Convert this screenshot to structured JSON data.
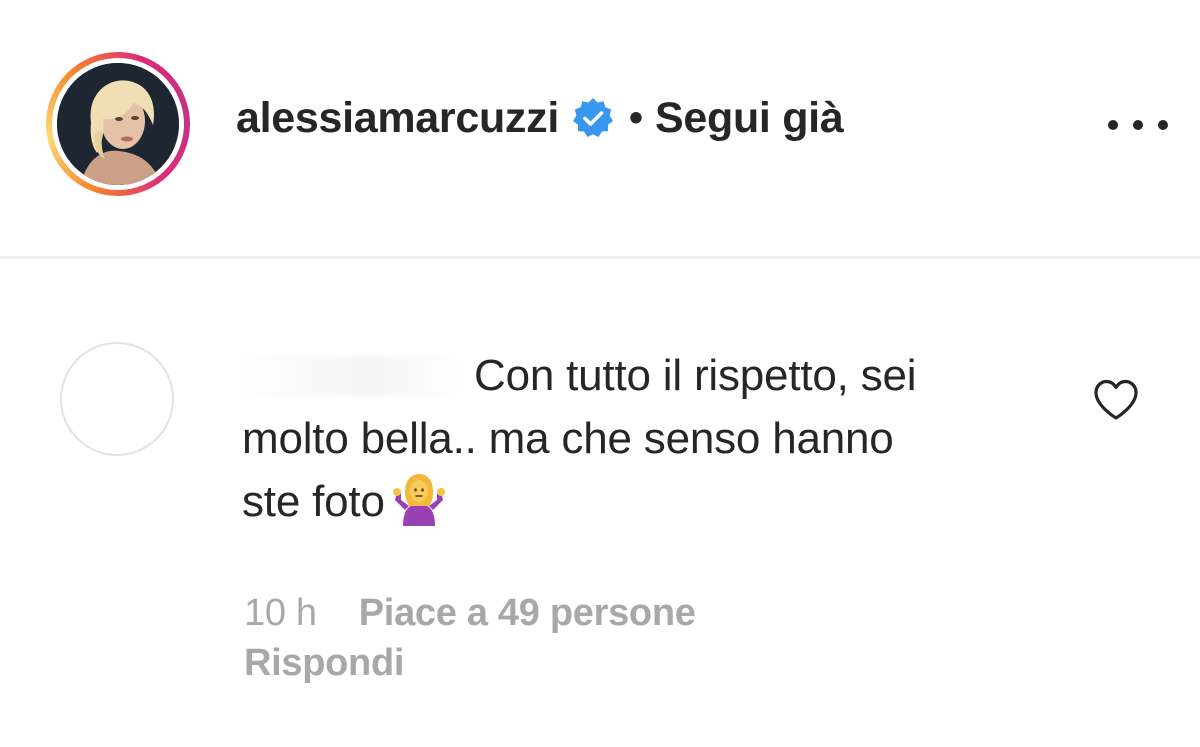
{
  "header": {
    "username": "alessiamarcuzzi",
    "verified_icon": "verified-badge-icon",
    "separator": "•",
    "follow_status": "Segui già",
    "more_icon": "more-options-icon",
    "avatar_icon": "profile-photo"
  },
  "comment": {
    "author_avatar_icon": "blank-avatar",
    "author_username": "",
    "text_line_1": "Con tutto il rispetto, sei",
    "text_line_2": "molto bella.. ma che senso hanno",
    "text_line_3": "ste foto",
    "emoji_icon": "person-shrugging-emoji",
    "time": "10 h",
    "likes": "Piace a 49 persone",
    "reply_label": "Rispondi",
    "like_icon": "heart-outline-icon"
  },
  "colors": {
    "text_primary": "#262626",
    "text_secondary": "#a8a8a8",
    "verified_blue": "#3897f0",
    "divider": "#efefef",
    "story_ring_start": "#f58529",
    "story_ring_end": "#dd2a7b"
  }
}
